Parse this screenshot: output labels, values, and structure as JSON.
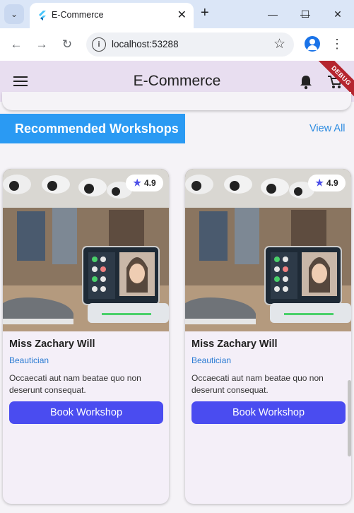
{
  "browser": {
    "tab_title": "E-Commerce",
    "url": "localhost:53288"
  },
  "app": {
    "title": "E-Commerce",
    "debug_banner": "DEBUG"
  },
  "section": {
    "title": "Recommended Workshops",
    "view_all": "View All"
  },
  "cards": [
    {
      "rating": "4.9",
      "name": "Miss Zachary Will",
      "role": "Beautician",
      "description": "Occaecati aut nam beatae quo non deserunt consequat.",
      "button": "Book Workshop"
    },
    {
      "rating": "4.9",
      "name": "Miss Zachary Will",
      "role": "Beautician",
      "description": "Occaecati aut nam beatae quo non deserunt consequat.",
      "button": "Book Workshop"
    }
  ],
  "colors": {
    "accent": "#2a9af3",
    "button": "#4a4cf0",
    "appbar": "#e8def0",
    "debug": "#b5252f"
  }
}
